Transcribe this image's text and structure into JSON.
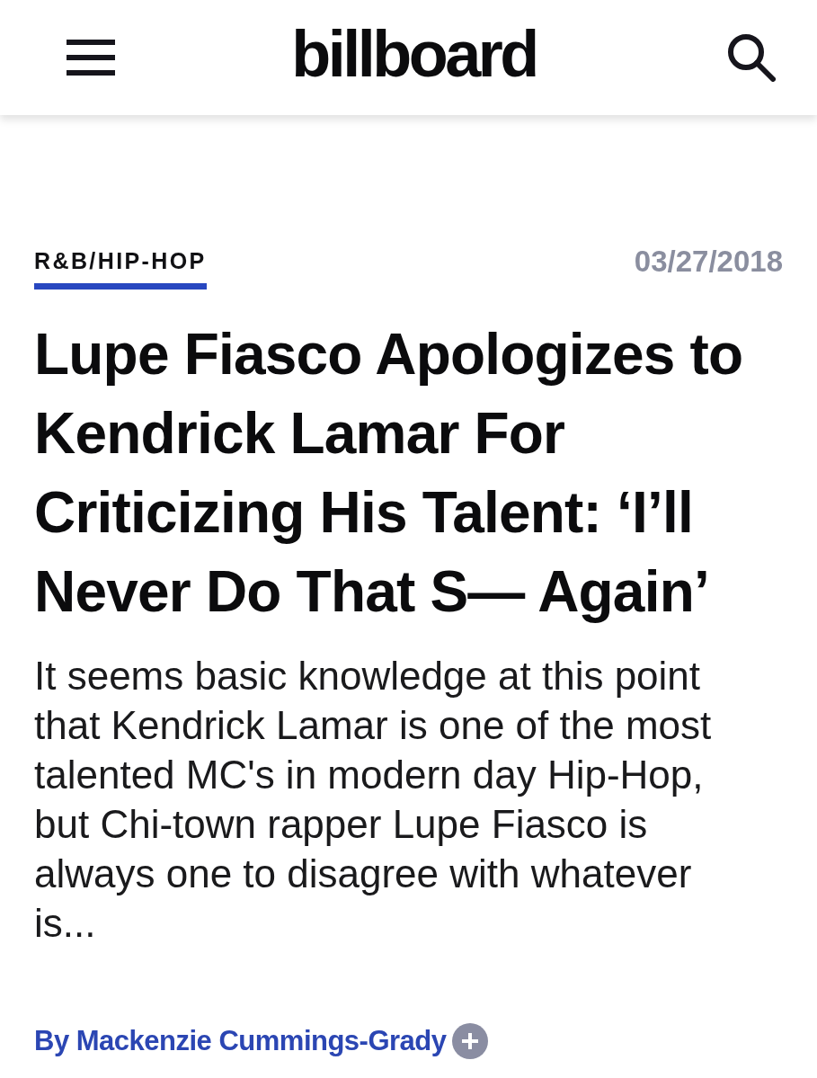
{
  "header": {
    "logo": "billboard"
  },
  "article": {
    "category": "R&B/HIP-HOP",
    "date": "03/27/2018",
    "title": "Lupe Fiasco Apologizes to Kendrick Lamar For Criticizing His Talent: ‘I’ll Never Do That S— Again’",
    "summary": "It seems basic knowledge at this point that Kendrick Lamar is one of the most talented MC's in modern day Hip-Hop, but Chi-town rapper Lupe Fiasco is always one to disagree with whatever is...",
    "byline": "By Mackenzie Cummings-Grady"
  }
}
